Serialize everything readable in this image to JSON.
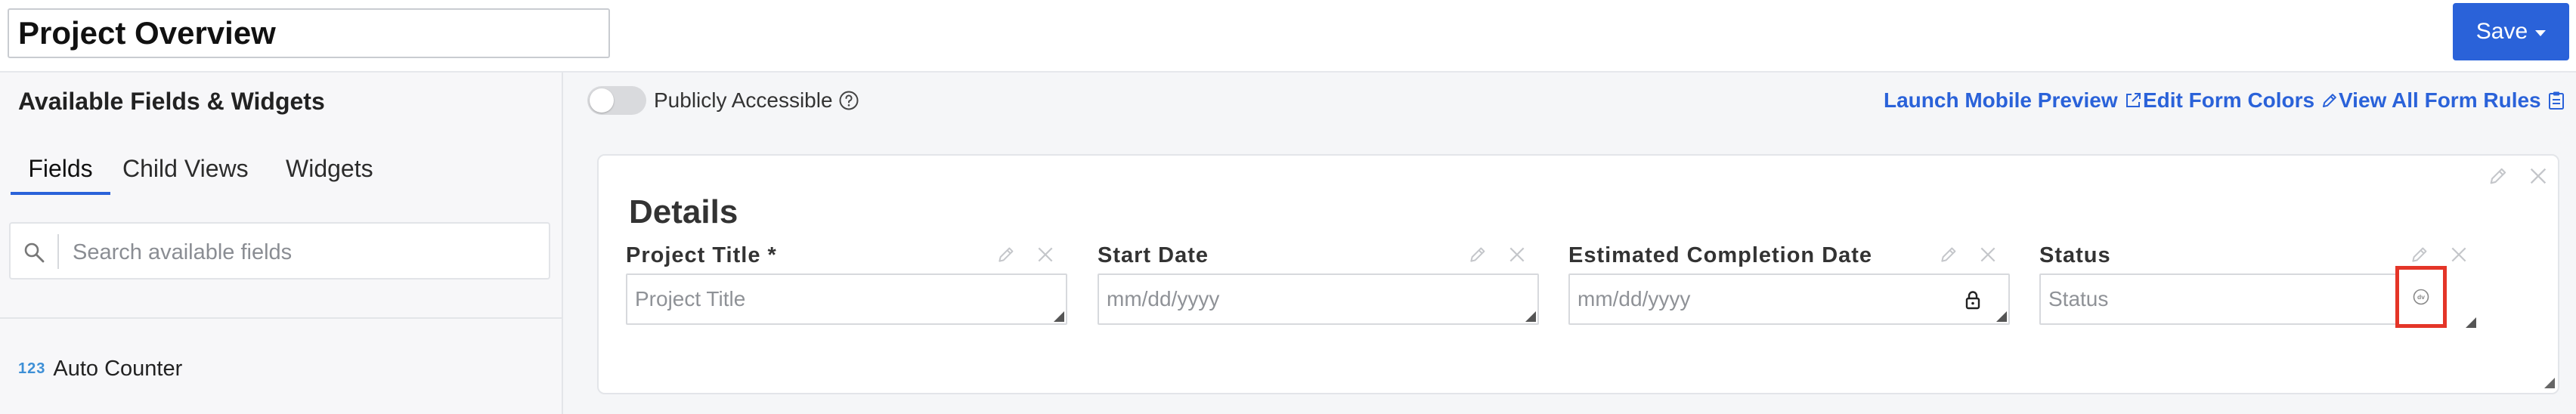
{
  "header": {
    "title_value": "Project Overview",
    "save_label": "Save"
  },
  "left_panel": {
    "heading": "Available Fields & Widgets",
    "tabs": [
      {
        "label": "Fields",
        "active": true
      },
      {
        "label": "Child Views",
        "active": false
      },
      {
        "label": "Widgets",
        "active": false
      }
    ],
    "search_placeholder": "Search available fields",
    "field_items": [
      {
        "icon": "123",
        "label": "Auto Counter"
      }
    ]
  },
  "toolbar": {
    "public_toggle_label": "Publicly Accessible",
    "public_toggle_on": false,
    "links": [
      {
        "label": "Launch Mobile Preview",
        "icon": "external-link-icon"
      },
      {
        "label": "Edit Form Colors",
        "icon": "pencil-icon"
      },
      {
        "label": "View All Form Rules",
        "icon": "clipboard-icon"
      }
    ]
  },
  "form": {
    "section_title": "Details",
    "fields": [
      {
        "label": "Project Title *",
        "placeholder": "Project Title"
      },
      {
        "label": "Start Date",
        "placeholder": "mm/dd/yyyy"
      },
      {
        "label": "Estimated Completion Date",
        "placeholder": "mm/dd/yyyy",
        "locked": true
      },
      {
        "label": "Status",
        "placeholder": "Status",
        "button_icon": "dv"
      }
    ]
  },
  "colors": {
    "accent": "#2a62d9",
    "highlight": "#e43528",
    "counter_icon": "#3d8fd6"
  }
}
